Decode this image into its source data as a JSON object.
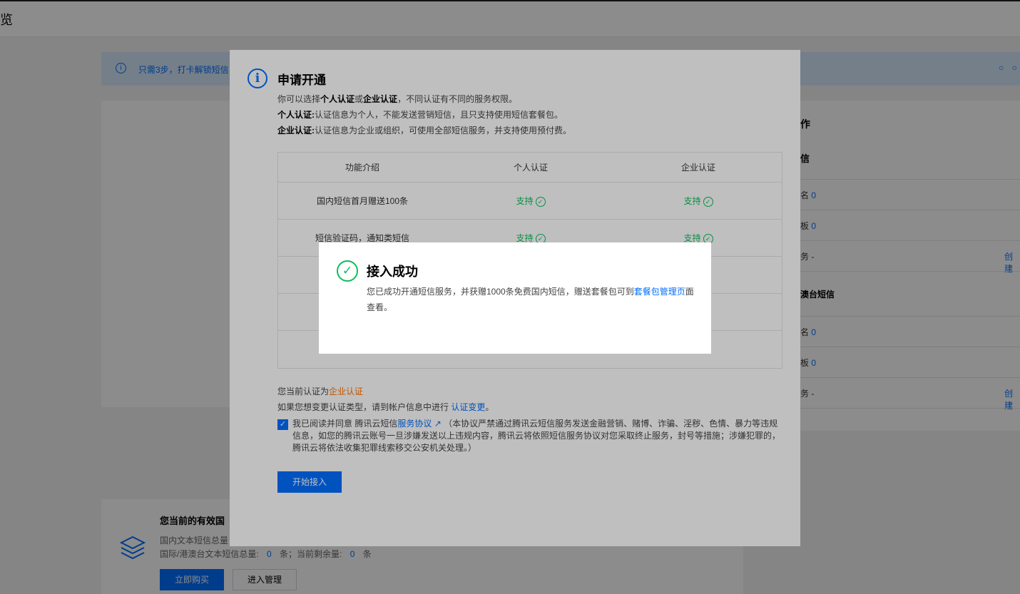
{
  "header": {
    "title": "览"
  },
  "tip": {
    "text": "只需3步，打卡解锁短信",
    "dots": "○ ○"
  },
  "right_panel": {
    "title": "作",
    "section1_title": "信",
    "rows1": [
      {
        "label": "名",
        "value": "0"
      },
      {
        "label": "板",
        "value": "0"
      },
      {
        "label": "务 -",
        "link": "创建"
      }
    ],
    "section2_title": "澳台短信",
    "rows2": [
      {
        "label": "名",
        "value": "0"
      },
      {
        "label": "板",
        "value": "0"
      },
      {
        "label": "务 -",
        "link": "创建"
      }
    ]
  },
  "bottom_card": {
    "title": "您当前的有效国",
    "line1": "国内文本短信总量",
    "line2_label": "国际/港澳台文本短信总量:",
    "line2_total": "0",
    "line2_unit": "条；当前剩余量:",
    "line2_remain": "0",
    "line2_unit2": "条",
    "buy_label": "立即购买",
    "manage_label": "进入管理"
  },
  "dialog": {
    "title": "申请开通",
    "desc_prefix": "你可以选择",
    "desc_personal": "个人认证",
    "desc_or": "或",
    "desc_enterprise": "企业认证",
    "desc_suffix": "，不同认证有不同的服务权限。",
    "personal_label": "个人认证:",
    "personal_text": "认证信息为个人，不能发送营销短信，且只支持使用短信套餐包。",
    "enterprise_label": "企业认证:",
    "enterprise_text": "认证信息为企业或组织，可使用全部短信服务，并支持使用预付费。",
    "table": {
      "headers": [
        "功能介绍",
        "个人认证",
        "企业认证"
      ],
      "rows": [
        [
          "国内短信首月赠送100条",
          "支持",
          "支持"
        ],
        [
          "短信验证码，通知类短信",
          "支持",
          "支持"
        ]
      ],
      "support_label": "支持"
    },
    "current_prefix": "您当前认证为",
    "current_value": "企业认证",
    "change_prefix": "如果您想变更认证类型，请到帐户信息中进行",
    "change_link": "认证变更",
    "change_suffix": "。",
    "agree_prefix": "我已阅读并同意 腾讯云短信",
    "agree_link": "服务协议",
    "agree_text": "（本协议严禁通过腾讯云短信服务发送金融营销、赌博、诈骗、淫秽、色情、暴力等违规信息，如您的腾讯云账号一旦涉嫌发送以上违规内容，腾讯云将依照短信服务协议对您采取终止服务，封号等措施；涉嫌犯罪的，腾讯云将依法收集犯罪线索移交公安机关处理。）",
    "start_label": "开始接入"
  },
  "success": {
    "title": "接入成功",
    "body_prefix": "您已成功开通短信服务，并获赠1000条免费国内短信，赠送套餐包可到",
    "body_link": "套餐包管理页",
    "body_suffix": "面查看。"
  },
  "colors": {
    "accent": "#006eff",
    "success": "#0abf5b",
    "warning": "#ff7200"
  }
}
